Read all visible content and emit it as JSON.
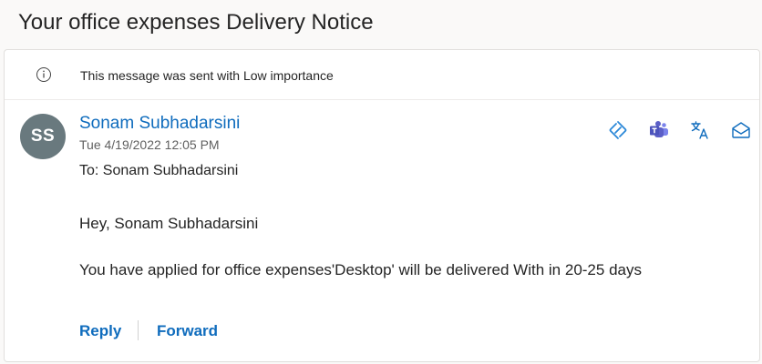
{
  "email": {
    "subject": "Your office expenses Delivery Notice",
    "importance_notice": "This message was sent with Low importance",
    "sender": {
      "initials": "SS",
      "name": "Sonam Subhadarsini",
      "avatar_color": "#69797e"
    },
    "timestamp": "Tue 4/19/2022 12:05 PM",
    "to_line": "To: Sonam Subhadarsini",
    "body": {
      "greeting": "Hey, Sonam Subhadarsini",
      "message": "You have applied for office expenses'Desktop' will be delivered With in 20-25 days"
    },
    "actions": {
      "reply": "Reply",
      "forward": "Forward"
    }
  },
  "toolbar_icons": [
    "loop-icon",
    "teams-icon",
    "translate-icon",
    "mark-unread-icon"
  ],
  "colors": {
    "link": "#0f6cbd",
    "teams": "#5b5fc7",
    "loop": "#2b88d8"
  }
}
